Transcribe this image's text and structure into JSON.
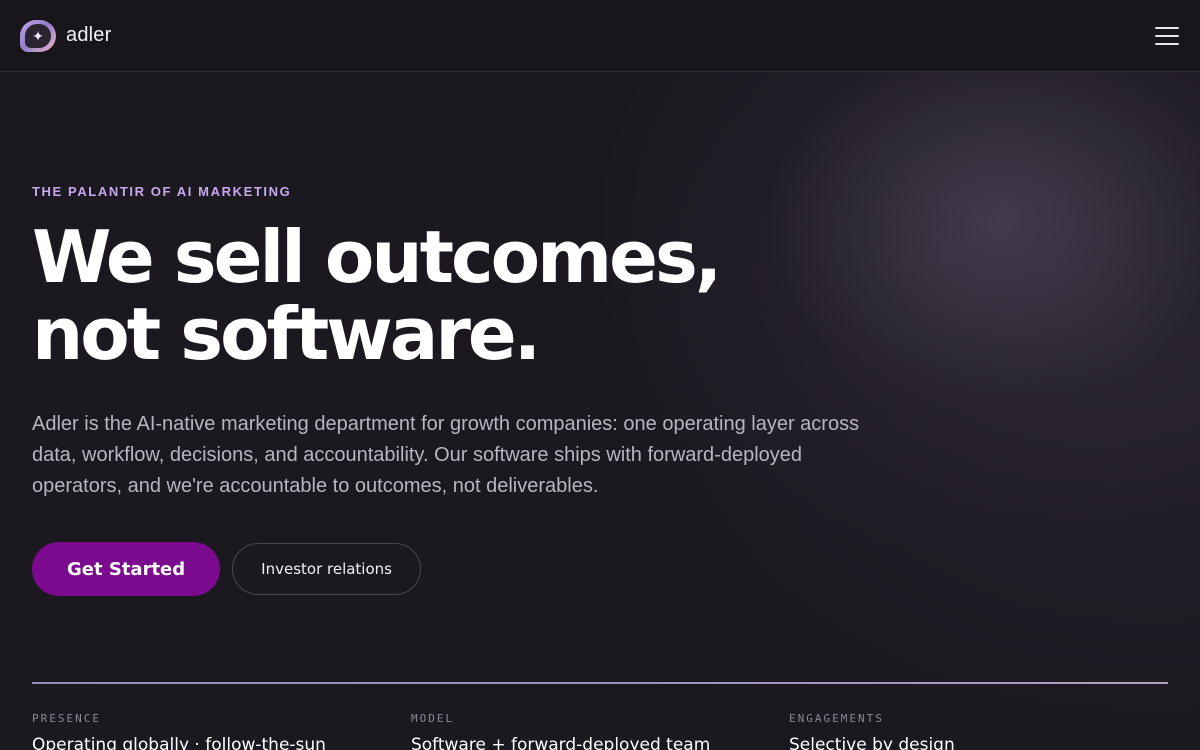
{
  "header": {
    "brand_name": "adler",
    "logo_icon": "sparkle-icon",
    "menu_icon": "hamburger-menu-icon"
  },
  "hero": {
    "eyebrow": "THE PALANTIR OF AI MARKETING",
    "headline_line1": "We sell outcomes,",
    "headline_line2": "not software.",
    "lede": "Adler is the AI-native marketing department for growth companies: one operating layer across data, workflow, decisions, and accountability. Our software ships with forward-deployed operators, and we're accountable to outcomes, not deliverables.",
    "primary_cta": "Get Started",
    "secondary_cta": "Investor relations"
  },
  "stats": [
    {
      "label": "PRESENCE",
      "value": "Operating globally · follow-the-sun"
    },
    {
      "label": "MODEL",
      "value": "Software + forward-deployed team"
    },
    {
      "label": "ENGAGEMENTS",
      "value": "Selective by design"
    }
  ],
  "colors": {
    "accent": "#7b0a8f",
    "eyebrow": "#c9a8ef",
    "background": "#1b181f"
  }
}
